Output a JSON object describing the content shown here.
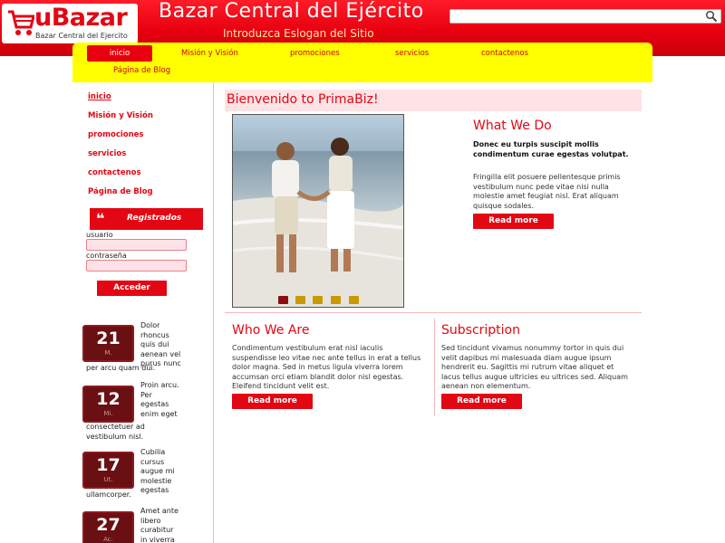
{
  "header": {
    "logo_text": "uBazar",
    "logo_sub": "Bazar Central del Ejercito",
    "site_title": "Bazar Central del Ejército",
    "slogan": "Introduzca Eslogan del Sitio",
    "search_value": "",
    "search_icon": "search-icon"
  },
  "nav": {
    "items": [
      {
        "label": "inicio",
        "active": true
      },
      {
        "label": "Misión y Visión"
      },
      {
        "label": "promociones"
      },
      {
        "label": "servicios"
      },
      {
        "label": "contactenos"
      },
      {
        "label": "Página de Blog"
      }
    ]
  },
  "sidebar": {
    "links": [
      "inicio",
      "Misión y Visión",
      "promociones",
      "servicios",
      "contactenos",
      "Página de Blog"
    ],
    "registered_title": "Registrados",
    "user_label": "usuario",
    "password_label": "contraseña",
    "login_button": "Acceder",
    "posts": [
      {
        "day": "21",
        "month": "M.",
        "text_side": [
          "Dolor",
          "rhoncus",
          "quis dui",
          "aenean vel",
          "purus nunc"
        ],
        "text_full": "per arcu quam dui."
      },
      {
        "day": "12",
        "month": "Mi.",
        "text_side": [
          "Proin arcu.",
          "Per",
          "egestas",
          "enim eget"
        ],
        "text_full": [
          "consectetuer ad",
          "vestibulum nisl."
        ]
      },
      {
        "day": "17",
        "month": "Ut.",
        "text_side": [
          "Cubilia",
          "cursus",
          "augue mi",
          "molestie",
          "egestas"
        ],
        "text_full": "ullamcorper."
      },
      {
        "day": "27",
        "month": "Ac.",
        "text_side": [
          "Amet ante",
          "libero",
          "curabitur",
          "in viverra"
        ],
        "text_full": ""
      }
    ]
  },
  "main": {
    "welcome": "Bienvenido to PrimaBiz!",
    "what": {
      "title": "What We Do",
      "bold": "Donec eu turpis suscipit mollis condimentum curae egestas volutpat.",
      "text": "Fringilla elit posuere pellentesque primis vestibulum nunc pede vitae nisi nulla molestie amet feugiat nisl. Erat aliquam quisque sodales.",
      "button": "Read more"
    },
    "who": {
      "title": "Who We Are",
      "text": "Condimentum vestibulum erat nisl iaculis suspendisse leo vitae nec ante tellus in erat a tellus dolor magna. Sed in metus ligula viverra lorem accumsan orci etiam blandit dolor nisl egestas. Eleifend tincidunt velit est.",
      "button": "Read more"
    },
    "subscription": {
      "title": "Subscription",
      "text": "Sed tincidunt vivamus nonummy tortor in quis dui velit dapibus mi malesuada diam augue ipsum hendrerit eu. Sagittis mi rutrum vitae aliquet et lacus tellus augue ultricies eu ultrices sed. Aliquam aenean non elementum.",
      "button": "Read more"
    },
    "slider_dots": [
      {
        "color": "#8b0f12",
        "active": true
      },
      {
        "color": "#c99a00"
      },
      {
        "color": "#c99a00"
      },
      {
        "color": "#c99a00"
      },
      {
        "color": "#c99a00"
      }
    ]
  },
  "colors": {
    "brand_red": "#e30613",
    "nav_yellow": "#ffff00",
    "welcome_bg": "#fde3e5"
  }
}
